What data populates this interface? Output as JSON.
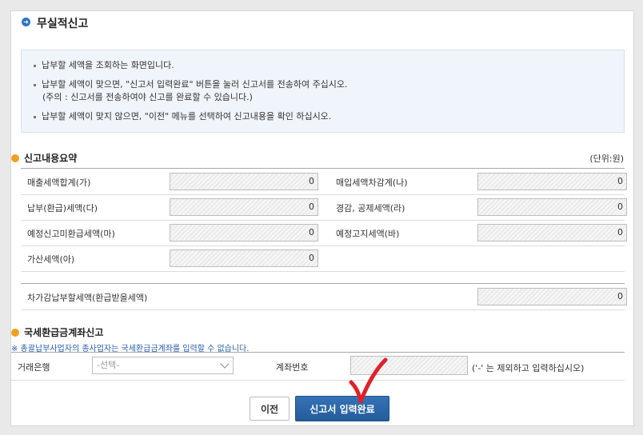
{
  "header": {
    "title": "무실적신고"
  },
  "info": {
    "line1": "납부할 세액을 조회하는 화면입니다.",
    "line2": "납부할 세액이 맞으면, \"신고서 입력완료\" 버튼을 눌러 신고서를 전송하여 주십시오.",
    "line2_note": "(주의 : 신고서를 전송하여야 신고를 완료할 수 있습니다.)",
    "line3": "납부할 세액이 맞지 않으면, \"이전\" 메뉴를 선택하여 신고내용을 확인 하십시오."
  },
  "summary": {
    "title": "신고내용요약",
    "unit": "(단위:원)",
    "rows": [
      {
        "label_left": "매출세액합계(가)",
        "value_left": "0",
        "label_right": "매입세액차감계(나)",
        "value_right": "0"
      },
      {
        "label_left": "납부(환급)세액(다)",
        "value_left": "0",
        "label_right": "경감, 공제세액(라)",
        "value_right": "0"
      },
      {
        "label_left": "예정신고미환급세액(마)",
        "value_left": "0",
        "label_right": "예정고지세액(바)",
        "value_right": "0"
      },
      {
        "label_left": "가산세액(아)",
        "value_left": "0"
      }
    ],
    "total_label": "차가감납부할세액(환급받을세액)",
    "total_value": "0"
  },
  "refund": {
    "title": "국세환급금계좌신고",
    "note": "※ 총괄납부사업자의 종사업자는 국세환급금계좌를 입력할 수 없습니다.",
    "bank_label": "거래은행",
    "bank_placeholder": "-선택-",
    "account_label": "계좌번호",
    "account_hint": "('-' 는 제외하고 입력하십시오)"
  },
  "buttons": {
    "prev": "이전",
    "submit": "신고서 입력완료"
  },
  "colors": {
    "accent": "#2f74c0",
    "submit": "#2a63a6",
    "check": "#e2202a"
  }
}
